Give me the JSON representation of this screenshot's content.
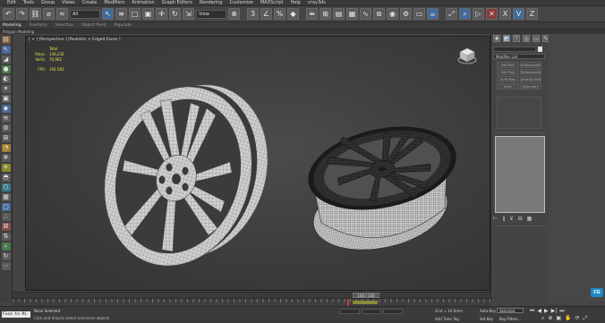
{
  "menu": [
    "Edit",
    "Tools",
    "Group",
    "Views",
    "Create",
    "Modifiers",
    "Animation",
    "Graph Editors",
    "Rendering",
    "Customize",
    "MAXScript",
    "Help",
    "vray3ds"
  ],
  "toolbar": {
    "selection_filter": "All",
    "view_dropdown": "View",
    "icons": [
      "undo-icon",
      "redo-icon",
      "link-icon",
      "unlink-icon",
      "bind-icon",
      "select-icon",
      "select-by-name-icon",
      "rect-select-icon",
      "window-crossing-icon",
      "move-icon",
      "rotate-icon",
      "scale-icon",
      "pivot-icon",
      "snap-icon",
      "angle-snap-icon",
      "percent-snap-icon",
      "mirror-icon",
      "align-icon",
      "layer-icon",
      "curve-editor-icon",
      "schematic-icon",
      "material-editor-icon",
      "render-setup-icon",
      "rendered-frame-icon",
      "render-icon"
    ]
  },
  "ribbon": {
    "tabs": [
      "Modeling",
      "Freeform",
      "Selection",
      "Object Paint",
      "Populate"
    ],
    "active_tab": "Modeling",
    "subpanel": "Polygon Modeling"
  },
  "viewport": {
    "label": "[ + ] [Perspective ] [Realistic + Edged Faces ]",
    "stats": {
      "header": "Total",
      "polys_label": "Polys:",
      "polys_value": "136,232",
      "verts_label": "Verts:",
      "verts_value": "70,962",
      "fps_label": "FPS:",
      "fps_value": "192.583"
    }
  },
  "command_panel": {
    "tab_icons": [
      "create-icon",
      "modify-icon",
      "hierarchy-icon",
      "motion-icon",
      "display-icon",
      "utilities-icon"
    ],
    "modifier_list_label": "Modifier List",
    "modifier_buttons": [
      "Edit Poly",
      "Turbosmooth",
      "Edit Poly",
      "Turbosmooth",
      "UVW Map",
      "Unwrap UVW",
      "Shell",
      "Symmetry"
    ]
  },
  "timeline": {
    "frame_display": "100 / 100"
  },
  "status": {
    "maxscript_text": "Fuse to Mi",
    "selection_text": "None Selected",
    "prompt_text": "Click and drag to select and move objects",
    "grid_text": "Grid = 10.0mm",
    "add_time_tag": "Add Time Tag",
    "auto_key": "Auto Key",
    "auto_key_mode": "Selected",
    "set_key": "Set Key",
    "key_filters": "Key Filters..."
  },
  "badge": {
    "text": "CG"
  },
  "colors": {
    "accent_blue": "#3f6b9a",
    "stats_yellow": "#e6e646",
    "badge_blue": "#1e88c7"
  }
}
